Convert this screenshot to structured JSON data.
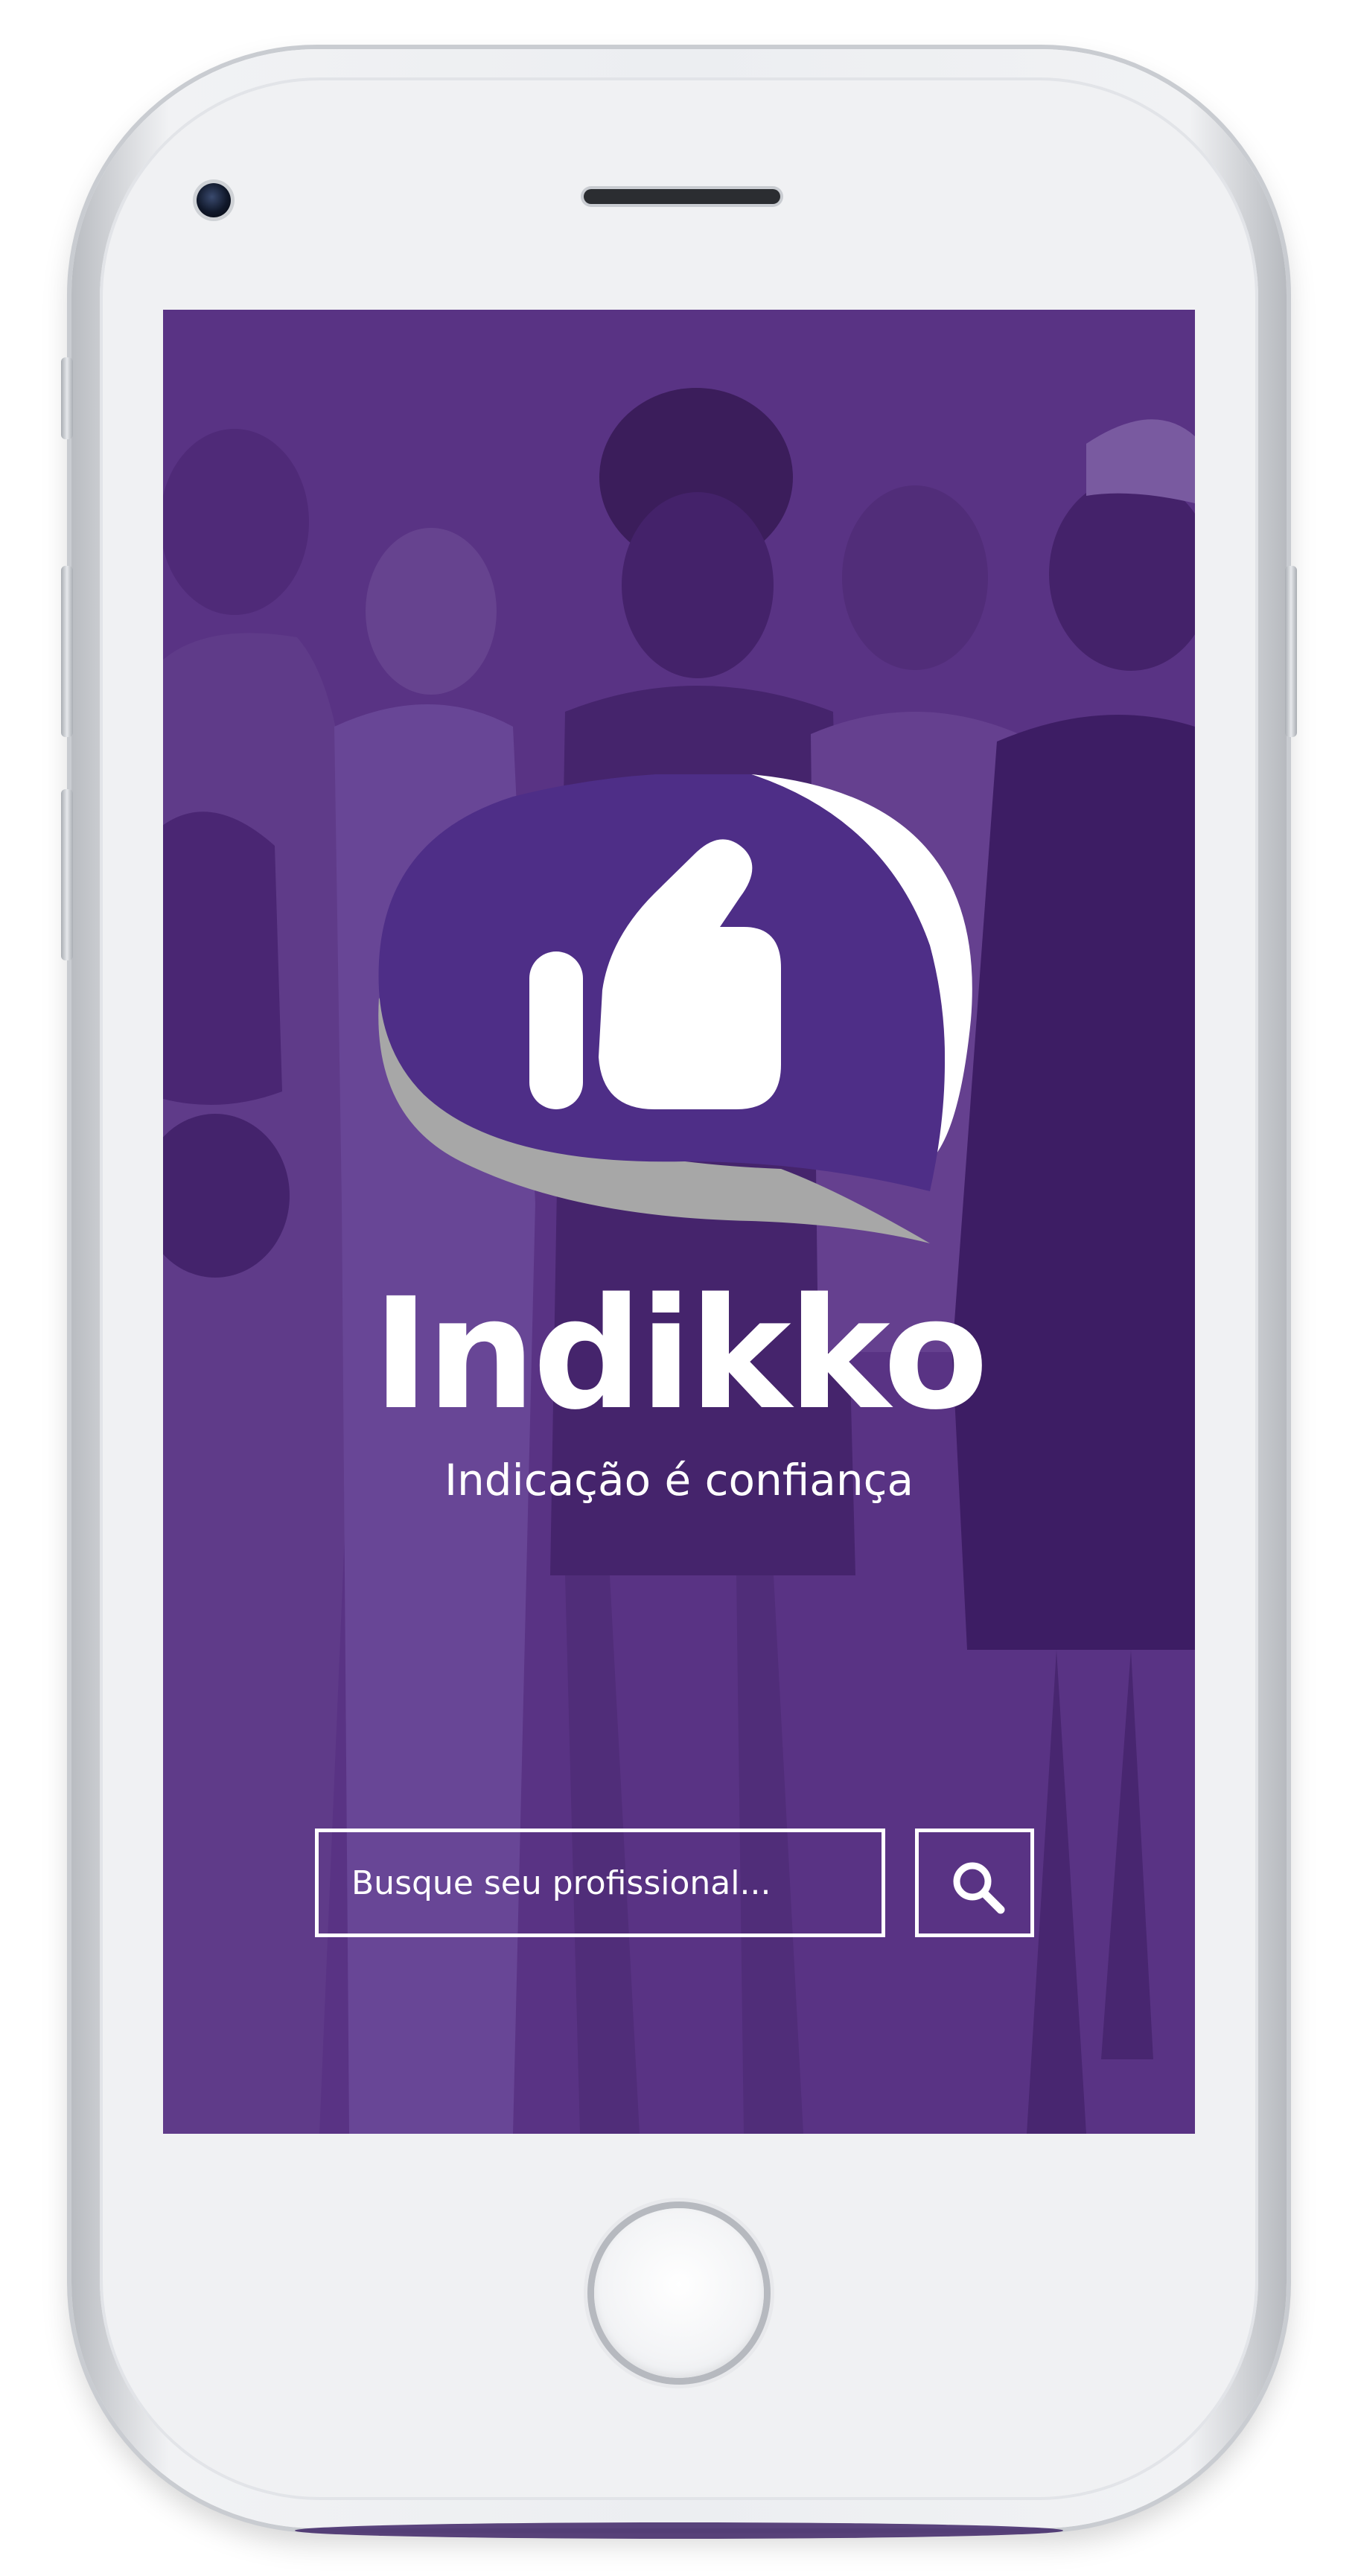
{
  "app": {
    "brand_name": "Indikko",
    "tagline": "Indicação é confiança"
  },
  "search": {
    "placeholder": "Busque seu profissional...",
    "value": "",
    "button_icon": "search-icon"
  },
  "icons": {
    "logo": "thumbs-up-speech-bubble-icon",
    "camera": "front-camera-icon",
    "home": "home-button"
  },
  "colors": {
    "brand_purple": "#5a3384",
    "logo_bubble": "#4e2e87",
    "logo_shadow": "#a7a7a7",
    "text": "#ffffff"
  }
}
